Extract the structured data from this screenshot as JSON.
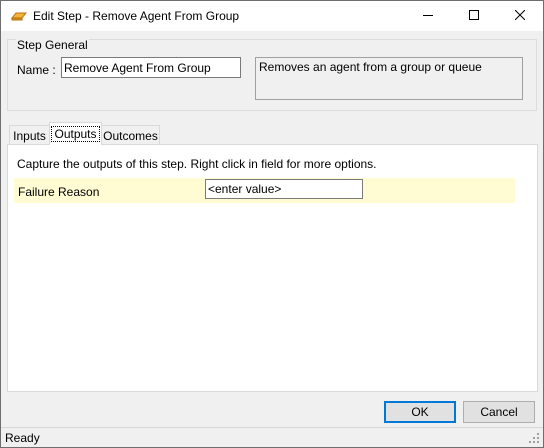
{
  "window": {
    "title": "Edit Step - Remove Agent From Group",
    "icon": "step-icon"
  },
  "title_buttons": {
    "minimize_icon": "minimize-icon",
    "maximize_icon": "maximize-icon",
    "close_icon": "close-icon"
  },
  "step_general": {
    "legend": "Step General",
    "name_label": "Name :",
    "name_value": "Remove Agent From Group",
    "description": "Removes an agent from a group or queue"
  },
  "tabs": [
    {
      "label": "Inputs",
      "selected": false
    },
    {
      "label": "Outputs",
      "selected": true
    },
    {
      "label": "Outcomes",
      "selected": false
    }
  ],
  "outputs": {
    "caption": "Capture the outputs of this step.  Right click in field for more options.",
    "rows": [
      {
        "label": "Failure Reason",
        "value": "",
        "placeholder": "<enter value>"
      }
    ]
  },
  "buttons": {
    "ok": "OK",
    "cancel": "Cancel"
  },
  "status": {
    "text": "Ready"
  },
  "colors": {
    "row_highlight": "#fffbd2",
    "default_button_border": "#0078d7",
    "dialog_background": "#f0f0f0"
  }
}
